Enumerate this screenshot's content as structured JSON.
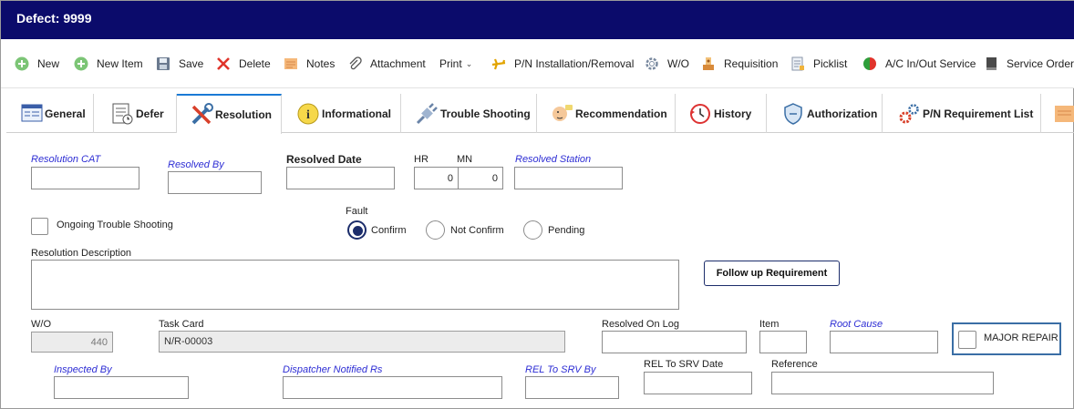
{
  "window": {
    "title": "Defect: 9999"
  },
  "toolbar": {
    "new": "New",
    "new_item": "New Item",
    "save": "Save",
    "delete": "Delete",
    "notes": "Notes",
    "attachment": "Attachment",
    "print": "Print",
    "pn_installation": "P/N Installation/Removal",
    "wo": "W/O",
    "requisition": "Requisition",
    "picklist": "Picklist",
    "ac_inout": "A/C In/Out Service",
    "service_order": "Service Order"
  },
  "tabs": {
    "general": "General",
    "defer": "Defer",
    "resolution": "Resolution",
    "informational": "Informational",
    "trouble_shooting": "Trouble Shooting",
    "recommendation": "Recommendation",
    "history": "History",
    "authorization": "Authorization",
    "pn_requirement": "P/N Requirement List"
  },
  "form": {
    "resolution_cat": {
      "label": "Resolution CAT",
      "value": ""
    },
    "resolved_by": {
      "label": "Resolved By",
      "value": ""
    },
    "resolved_date": {
      "label": "Resolved Date",
      "value": ""
    },
    "hr": {
      "label": "HR",
      "value": "0"
    },
    "mn": {
      "label": "MN",
      "value": "0"
    },
    "resolved_station": {
      "label": "Resolved Station",
      "value": ""
    },
    "ongoing_trouble": {
      "label": "Ongoing Trouble Shooting",
      "checked": false
    },
    "fault": {
      "label": "Fault",
      "options": [
        "Confirm",
        "Not Confirm",
        "Pending"
      ],
      "selected": "Confirm"
    },
    "resolution_description": {
      "label": "Resolution Description",
      "value": ""
    },
    "follow_up_button": "Follow up Requirement",
    "wo": {
      "label": "W/O",
      "value": "440"
    },
    "task_card": {
      "label": "Task Card",
      "value": "N/R-00003"
    },
    "resolved_on_log": {
      "label": "Resolved On Log",
      "value": ""
    },
    "item": {
      "label": "Item",
      "value": ""
    },
    "root_cause": {
      "label": "Root Cause",
      "value": ""
    },
    "major_repair": {
      "label": "MAJOR REPAIR",
      "checked": false
    },
    "inspected_by": {
      "label": "Inspected By",
      "value": ""
    },
    "dispatcher_notified": {
      "label": "Dispatcher Notified Rs",
      "value": ""
    },
    "rel_to_srv_by": {
      "label": "REL To SRV By",
      "value": ""
    },
    "rel_to_srv_date": {
      "label": "REL To SRV Date",
      "value": ""
    },
    "reference": {
      "label": "Reference",
      "value": ""
    }
  },
  "colors": {
    "title_bg": "#0b0b6b",
    "link_label": "#2d2dd4",
    "active_tab": "#1a7ad6",
    "major_border": "#3a6ea5"
  }
}
